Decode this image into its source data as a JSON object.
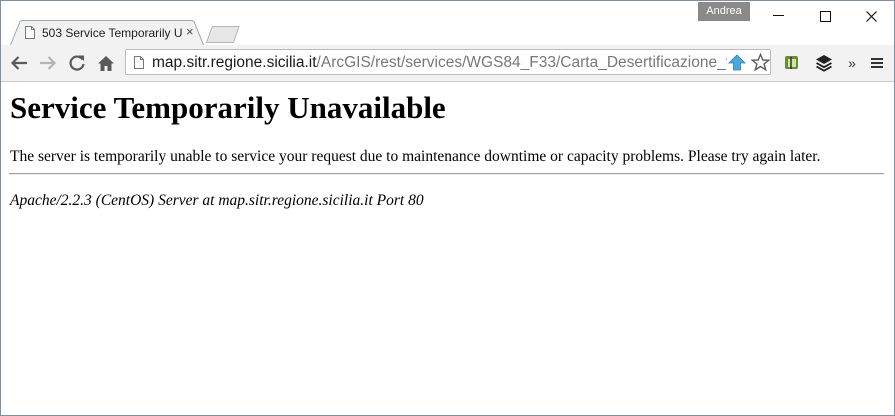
{
  "window": {
    "profile_name": "Andrea",
    "minimize_glyph": "—",
    "maximize_glyph": "☐",
    "close_glyph": "✕"
  },
  "tabs": [
    {
      "title": "503 Service Temporarily U",
      "close_glyph": "×",
      "active": true
    }
  ],
  "toolbar": {
    "url_host": "map.sitr.regione.sicilia.it",
    "url_path": "/ArcGIS/rest/services/WGS84_F33/Carta_Desertificazione_t",
    "overflow_glyph": "»"
  },
  "page": {
    "heading": "Service Temporarily Unavailable",
    "message": "The server is temporarily unable to service your request due to maintenance downtime or capacity problems. Please try again later.",
    "server_signature": "Apache/2.2.3 (CentOS) Server at map.sitr.regione.sicilia.it Port 80"
  },
  "icons": [
    "page-icon",
    "back-arrow-icon",
    "forward-arrow-icon",
    "reload-icon",
    "home-icon",
    "upload-arrow-icon",
    "star-icon",
    "extension-icon",
    "layers-icon",
    "menu-icon"
  ],
  "colors": {
    "frame_border": "#7f8fa6",
    "toolbar_bg": "#f2f2f2",
    "profile_bg": "#8a8a8a"
  }
}
